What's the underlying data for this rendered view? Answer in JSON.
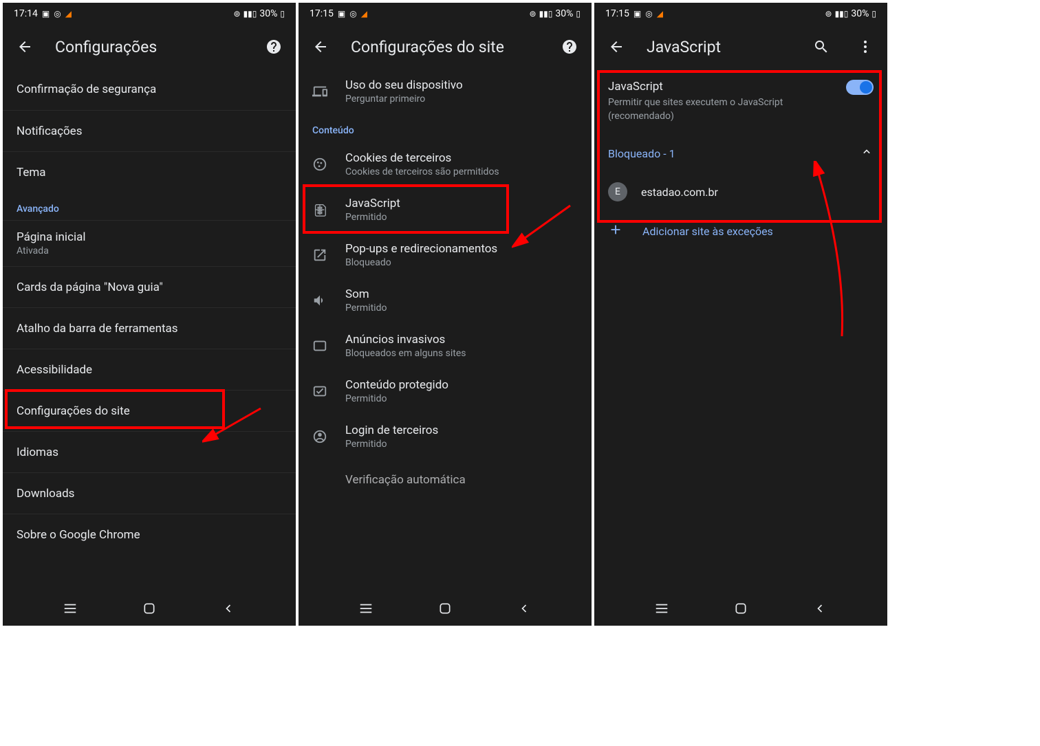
{
  "statusBar": {
    "time1": "17:14",
    "time2": "17:15",
    "time3": "17:15",
    "battery": "30%"
  },
  "screen1": {
    "title": "Configurações",
    "items": [
      {
        "title": "Confirmação de segurança",
        "sub": ""
      },
      {
        "title": "Notificações",
        "sub": ""
      },
      {
        "title": "Tema",
        "sub": ""
      }
    ],
    "sectionHeader": "Avançado",
    "advancedItems": [
      {
        "title": "Página inicial",
        "sub": "Ativada"
      },
      {
        "title": "Cards da página \"Nova guia\"",
        "sub": ""
      },
      {
        "title": "Atalho da barra de ferramentas",
        "sub": ""
      },
      {
        "title": "Acessibilidade",
        "sub": ""
      },
      {
        "title": "Configurações do site",
        "sub": ""
      },
      {
        "title": "Idiomas",
        "sub": ""
      },
      {
        "title": "Downloads",
        "sub": ""
      },
      {
        "title": "Sobre o Google Chrome",
        "sub": ""
      }
    ]
  },
  "screen2": {
    "title": "Configurações do site",
    "topItem": {
      "title": "Uso do seu dispositivo",
      "sub": "Perguntar primeiro"
    },
    "sectionHeader": "Conteúdo",
    "items": [
      {
        "title": "Cookies de terceiros",
        "sub": "Cookies de terceiros são permitidos"
      },
      {
        "title": "JavaScript",
        "sub": "Permitido"
      },
      {
        "title": "Pop-ups e redirecionamentos",
        "sub": "Bloqueado"
      },
      {
        "title": "Som",
        "sub": "Permitido"
      },
      {
        "title": "Anúncios invasivos",
        "sub": "Bloqueados em alguns sites"
      },
      {
        "title": "Conteúdo protegido",
        "sub": "Permitido"
      },
      {
        "title": "Login de terceiros",
        "sub": "Permitido"
      },
      {
        "title": "Verificação automática",
        "sub": ""
      }
    ]
  },
  "screen3": {
    "title": "JavaScript",
    "setting": {
      "title": "JavaScript",
      "sub": "Permitir que sites executem o JavaScript (recomendado)"
    },
    "blockedHeader": "Bloqueado - 1",
    "blockedSites": [
      {
        "favicon": "E",
        "domain": "estadao.com.br"
      }
    ],
    "addException": "Adicionar site às exceções"
  }
}
